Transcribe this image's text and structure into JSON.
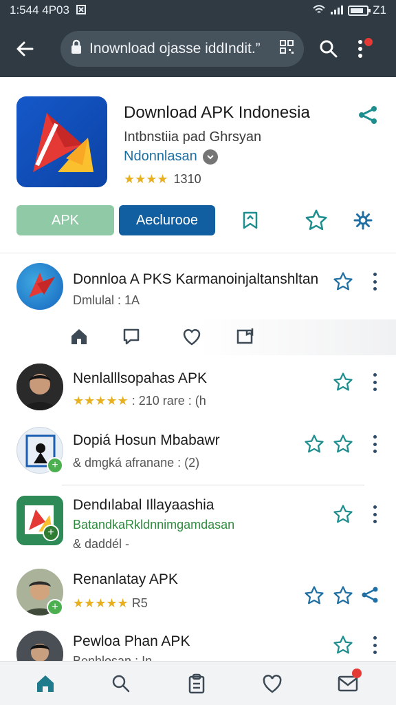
{
  "status_bar": {
    "time": "1:544 4P03",
    "battery_level": 0.8,
    "battery_label": "Z1"
  },
  "toolbar": {
    "url": "Inownload ojasse iddIndit.”",
    "icons": [
      "back-arrow-icon",
      "lock-icon",
      "qr-icon",
      "search-icon",
      "more-vert-icon"
    ]
  },
  "app": {
    "title": "Download APK Indonesia",
    "subtitle": "Intbnstiia pad Ghrsyan",
    "developer": "Ndonnlasan",
    "rating_stars": "★★★★",
    "rating_value": 4,
    "rating_count": "1310",
    "buttons": {
      "apk": "APK",
      "primary": "Aeclurooe"
    }
  },
  "list": [
    {
      "title": "Donnloa A PKS Karmanoinjaltanshltan",
      "meta": "Dmlulal : 1A"
    },
    {
      "title": "Nenlalllsopahas APK",
      "stars": "★★★★★",
      "meta": ": 210 rare : (h"
    },
    {
      "title": "Dopiá Hosun Mbabawr",
      "meta": "& dmgká afranane : (2)"
    },
    {
      "title": "Dendılabal Illayaashia",
      "meta_green": "BatandkaRkldnnimgamdasan",
      "meta": "& daddél -"
    },
    {
      "title": "Renanlatay APK",
      "stars": "★★★★★",
      "meta": "R5"
    },
    {
      "title": "Pewloa Phan APK",
      "meta": "Benhlosan : In"
    }
  ],
  "bottom_nav": [
    "home-icon",
    "search-icon",
    "clipboard-icon",
    "heart-icon",
    "mail-icon"
  ],
  "colors": {
    "bar_bg": "#2f3a43",
    "accent_blue": "#115fa0",
    "accent_teal": "#1f8e8e",
    "star_gold": "#e8b01f",
    "apk_green": "#90c9a6"
  }
}
